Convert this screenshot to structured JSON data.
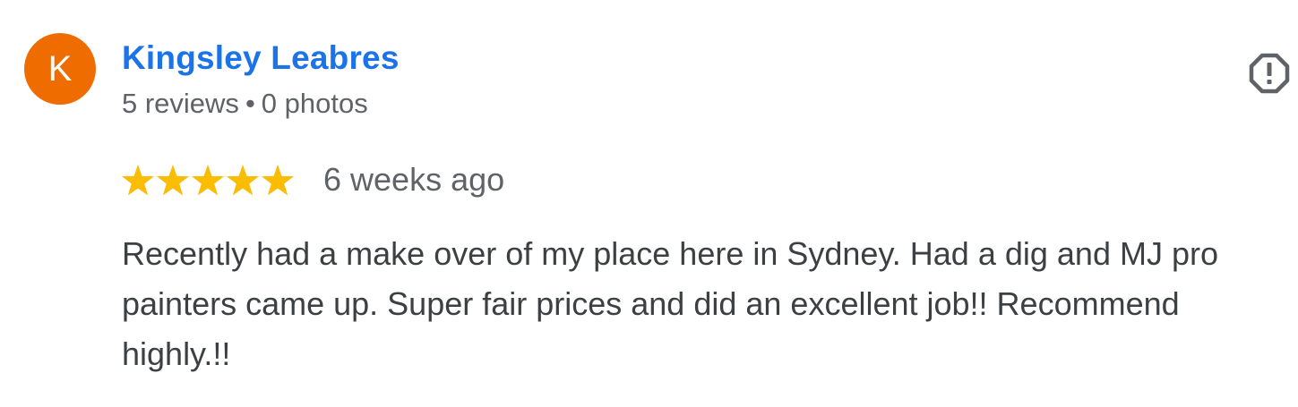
{
  "reviewer": {
    "initial": "K",
    "name": "Kingsley Leabres",
    "reviews": "5 reviews",
    "separator": "•",
    "photos": "0 photos",
    "avatar_color": "#ef6c00"
  },
  "report_icon": "report-flag-icon",
  "rating": {
    "stars": 5,
    "max_stars": 5,
    "star_color": "#fbbc04",
    "time_ago": "6 weeks ago"
  },
  "review": {
    "text": "Recently had a make over of my place here in Sydney. Had a dig and MJ pro painters came up. Super fair prices and did an excellent job!! Recommend highly.!!"
  },
  "colors": {
    "name_link": "#1a73e8",
    "meta_text": "#5f6368",
    "body_text": "#3c4043"
  }
}
